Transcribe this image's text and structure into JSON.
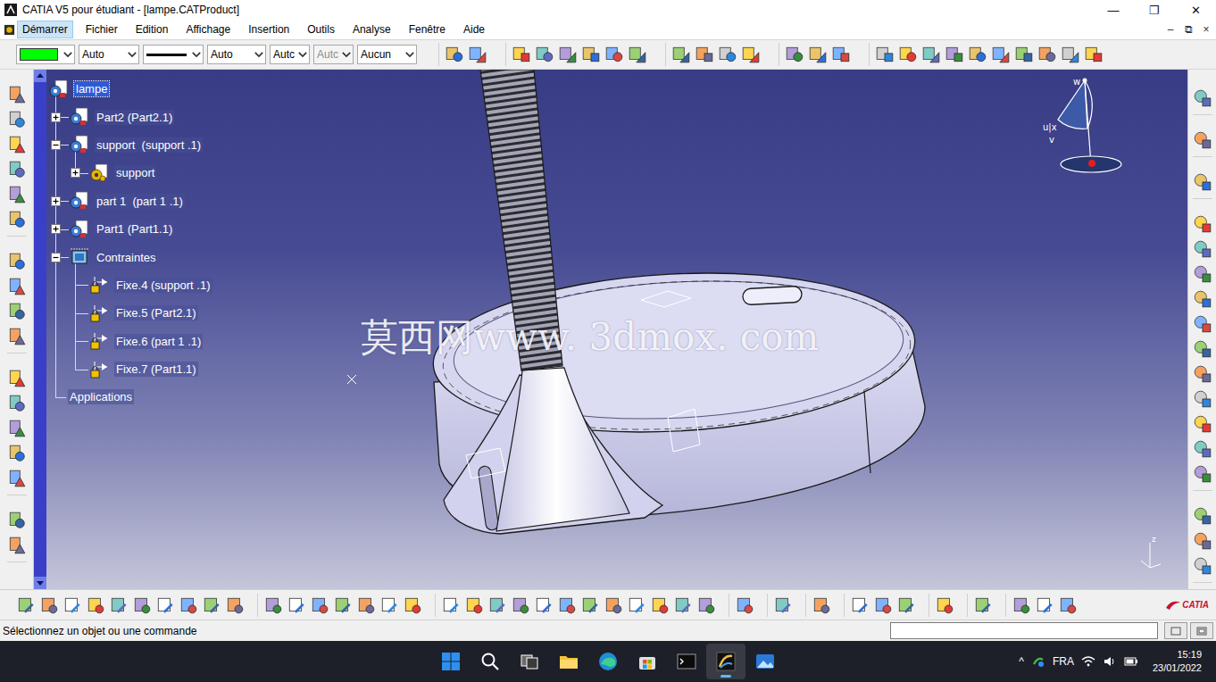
{
  "window": {
    "title": "CATIA V5 pour étudiant - [lampe.CATProduct]",
    "controls": [
      "—",
      "❐",
      "✕"
    ]
  },
  "menu": {
    "items": [
      {
        "label": "Démarrer",
        "selected": true
      },
      {
        "label": "Fichier",
        "selected": false
      },
      {
        "label": "Edition",
        "selected": false
      },
      {
        "label": "Affichage",
        "selected": false
      },
      {
        "label": "Insertion",
        "selected": false
      },
      {
        "label": "Outils",
        "selected": false
      },
      {
        "label": "Analyse",
        "selected": false
      },
      {
        "label": "Fenêtre",
        "selected": false
      },
      {
        "label": "Aide",
        "selected": false
      }
    ],
    "document_controls": [
      "–",
      "⧉",
      "×"
    ]
  },
  "properties_toolbar": {
    "fields": [
      {
        "kind": "color",
        "color": "#00ff00",
        "disabled": false
      },
      {
        "kind": "text",
        "value": "Auto",
        "disabled": false
      },
      {
        "kind": "line",
        "disabled": false
      },
      {
        "kind": "text",
        "value": "Auto",
        "disabled": false
      },
      {
        "kind": "text",
        "value": "Autc",
        "disabled": false
      },
      {
        "kind": "text",
        "value": "Autc",
        "disabled": true
      },
      {
        "kind": "text",
        "value": "Aucun",
        "disabled": false
      }
    ]
  },
  "tree": {
    "items": [
      {
        "label": "lampe",
        "depth": 0,
        "kind": "product",
        "expandable": false,
        "expanded": false,
        "selected": true
      },
      {
        "label": "Part2 (Part2.1)",
        "depth": 1,
        "kind": "component",
        "expandable": true,
        "expanded": false,
        "selected": false
      },
      {
        "label": "support  (support .1)",
        "depth": 1,
        "kind": "component",
        "expandable": true,
        "expanded": true,
        "selected": false
      },
      {
        "label": "support",
        "depth": 2,
        "kind": "part",
        "expandable": true,
        "expanded": false,
        "selected": false
      },
      {
        "label": "part 1  (part 1 .1)",
        "depth": 1,
        "kind": "component",
        "expandable": true,
        "expanded": false,
        "selected": false
      },
      {
        "label": "Part1 (Part1.1)",
        "depth": 1,
        "kind": "component",
        "expandable": true,
        "expanded": false,
        "selected": false
      },
      {
        "label": "Contraintes",
        "depth": 1,
        "kind": "constraints",
        "expandable": true,
        "expanded": true,
        "selected": false
      },
      {
        "label": "Fixe.4 (support .1)",
        "depth": 2,
        "kind": "fix",
        "expandable": false,
        "expanded": false,
        "selected": false
      },
      {
        "label": "Fixe.5 (Part2.1)",
        "depth": 2,
        "kind": "fix",
        "expandable": false,
        "expanded": false,
        "selected": false
      },
      {
        "label": "Fixe.6 (part 1 .1)",
        "depth": 2,
        "kind": "fix",
        "expandable": false,
        "expanded": false,
        "selected": false
      },
      {
        "label": "Fixe.7 (Part1.1)",
        "depth": 2,
        "kind": "fix",
        "expandable": false,
        "expanded": false,
        "selected": false
      },
      {
        "label": "Applications",
        "depth": 1,
        "kind": "applications",
        "expandable": false,
        "expanded": false,
        "selected": false
      }
    ]
  },
  "viewport": {
    "watermark": "莫西网www. 3dmox. com",
    "compass_labels": [
      "w",
      "u|x",
      "v"
    ],
    "axis_labels": [
      "z"
    ]
  },
  "logo": "CATIA",
  "status_bar": {
    "message": "Sélectionnez un objet ou une commande",
    "command_input": ""
  },
  "taskbar": {
    "apps": [
      {
        "kind": "start",
        "active": false
      },
      {
        "kind": "search",
        "active": false
      },
      {
        "kind": "task-view",
        "active": false
      },
      {
        "kind": "explorer",
        "active": false
      },
      {
        "kind": "edge",
        "active": false
      },
      {
        "kind": "store",
        "active": false
      },
      {
        "kind": "terminal",
        "active": false
      },
      {
        "kind": "catia",
        "active": true
      },
      {
        "kind": "photos",
        "active": false
      }
    ],
    "tray": {
      "overflow": "^",
      "language": "FRA",
      "time": "15:19",
      "date": "23/01/2022"
    }
  }
}
